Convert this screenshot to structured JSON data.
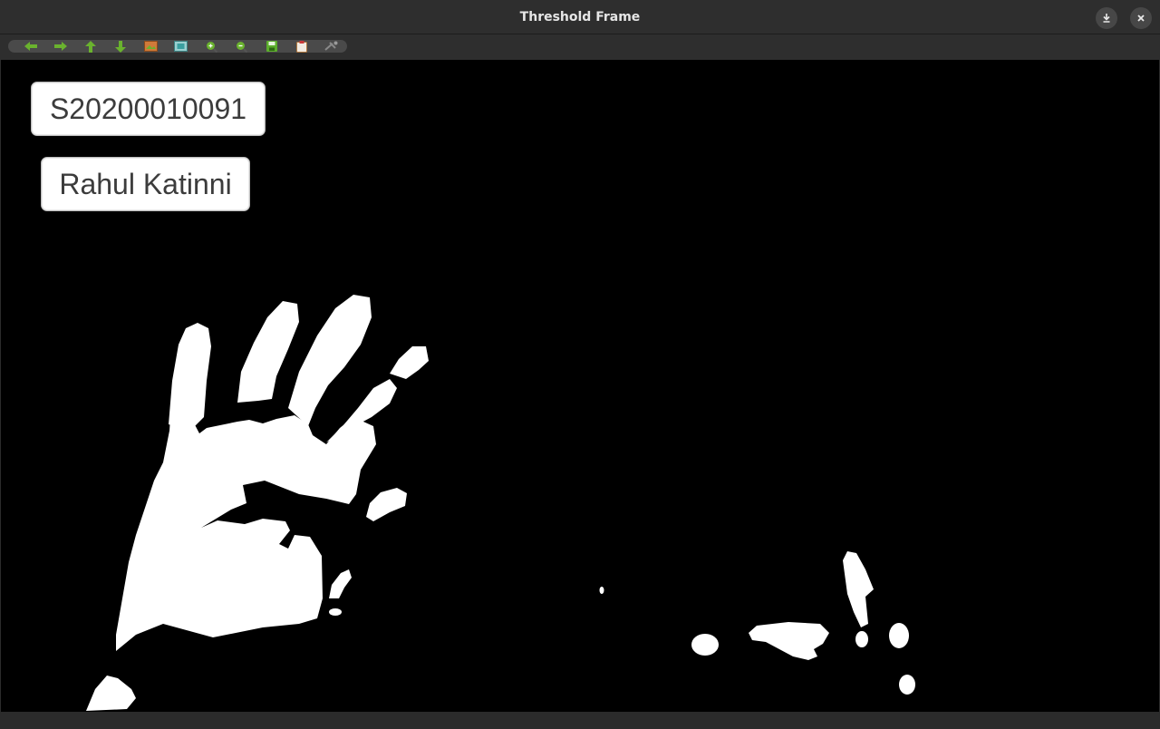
{
  "window": {
    "title": "Threshold Frame",
    "minimize_glyph": "⤓",
    "close_glyph": "✕"
  },
  "toolbar": {
    "buttons": [
      {
        "name": "pan-left",
        "icon": "arrow-left-icon",
        "color": "#6ab22e"
      },
      {
        "name": "pan-right",
        "icon": "arrow-right-icon",
        "color": "#6ab22e"
      },
      {
        "name": "pan-up",
        "icon": "arrow-up-icon",
        "color": "#6ab22e"
      },
      {
        "name": "pan-down",
        "icon": "arrow-down-icon",
        "color": "#6ab22e"
      },
      {
        "name": "zoom-image",
        "icon": "image-icon",
        "color": "#c0602a"
      },
      {
        "name": "zoom-fit",
        "icon": "fit-window-icon",
        "color": "#3aa0a0"
      },
      {
        "name": "zoom-in",
        "icon": "zoom-in-icon",
        "color": "#6ab22e"
      },
      {
        "name": "zoom-out",
        "icon": "zoom-out-icon",
        "color": "#6ab22e"
      },
      {
        "name": "save",
        "icon": "save-icon",
        "color": "#5cae2c"
      },
      {
        "name": "copy",
        "icon": "clipboard-icon",
        "color": "#c8a070"
      },
      {
        "name": "properties",
        "icon": "properties-icon",
        "color": "#8a8a8a"
      }
    ]
  },
  "overlay": {
    "id_label": "S20200010091",
    "name_label": "Rahul Katinni"
  },
  "colors": {
    "foreground_mask": "#ffffff",
    "background_mask": "#000000"
  }
}
